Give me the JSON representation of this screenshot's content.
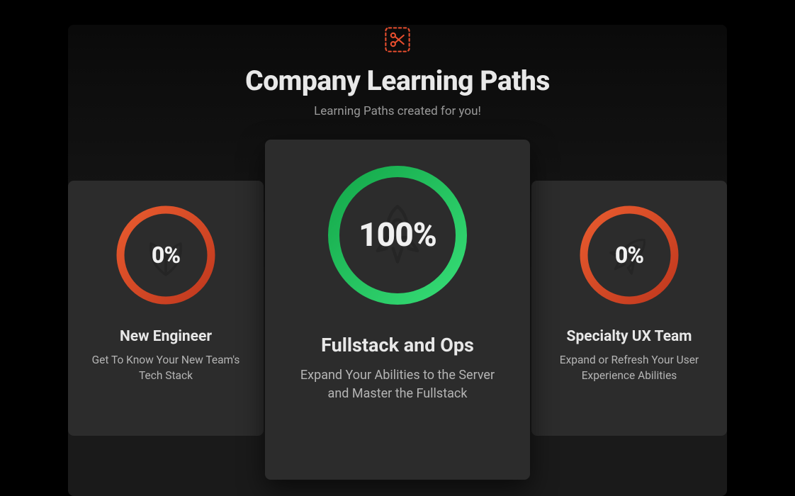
{
  "header": {
    "title": "Company Learning Paths",
    "subtitle": "Learning Paths created for you!"
  },
  "colors": {
    "orange_start": "#e84e2e",
    "orange_end": "#d1341a",
    "green_start": "#1fbb52",
    "green_end": "#2fd66f"
  },
  "cards": [
    {
      "title": "New Engineer",
      "description": "Get To Know Your New Team's Tech Stack",
      "progress": "0%",
      "progress_value": 0,
      "icon": "leaf"
    },
    {
      "title": "Fullstack and Ops",
      "description": "Expand Your Abilities to the Server and Master the Fullstack",
      "progress": "100%",
      "progress_value": 100,
      "icon": "rocket"
    },
    {
      "title": "Specialty UX Team",
      "description": "Expand or Refresh Your User Experience Abilities",
      "progress": "0%",
      "progress_value": 0,
      "icon": "rocket-diag"
    }
  ]
}
